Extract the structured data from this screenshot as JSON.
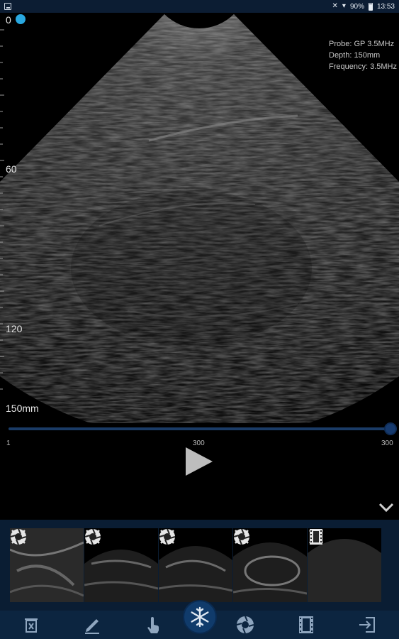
{
  "status_bar": {
    "battery": "90%",
    "time": "13:53",
    "icons": [
      "gallery-icon",
      "bluetooth-icon",
      "wifi-icon",
      "battery-icon"
    ]
  },
  "imaging": {
    "depth_top": "0",
    "depth_60": "60",
    "depth_120": "120",
    "depth_max": "150mm",
    "probe": "Probe:  GP 3.5MHz",
    "depth": "Depth:  150mm",
    "frequency": "Frequency:  3.5MHz"
  },
  "playback": {
    "slider_min": "1",
    "slider_mid": "300",
    "slider_max": "300",
    "position_fraction": 1.0
  },
  "thumbnails": [
    {
      "kind": "camera-icon"
    },
    {
      "kind": "camera-icon"
    },
    {
      "kind": "camera-icon"
    },
    {
      "kind": "camera-icon"
    },
    {
      "kind": "film-icon"
    }
  ],
  "toolbar": {
    "items": [
      "delete-icon",
      "pencil-icon",
      "touch-icon",
      "snowflake-icon",
      "camera-icon",
      "film-icon",
      "exit-icon"
    ]
  },
  "colors": {
    "accent": "#29a8e0",
    "bar": "#0c2540",
    "slider": "#1a3b66"
  }
}
